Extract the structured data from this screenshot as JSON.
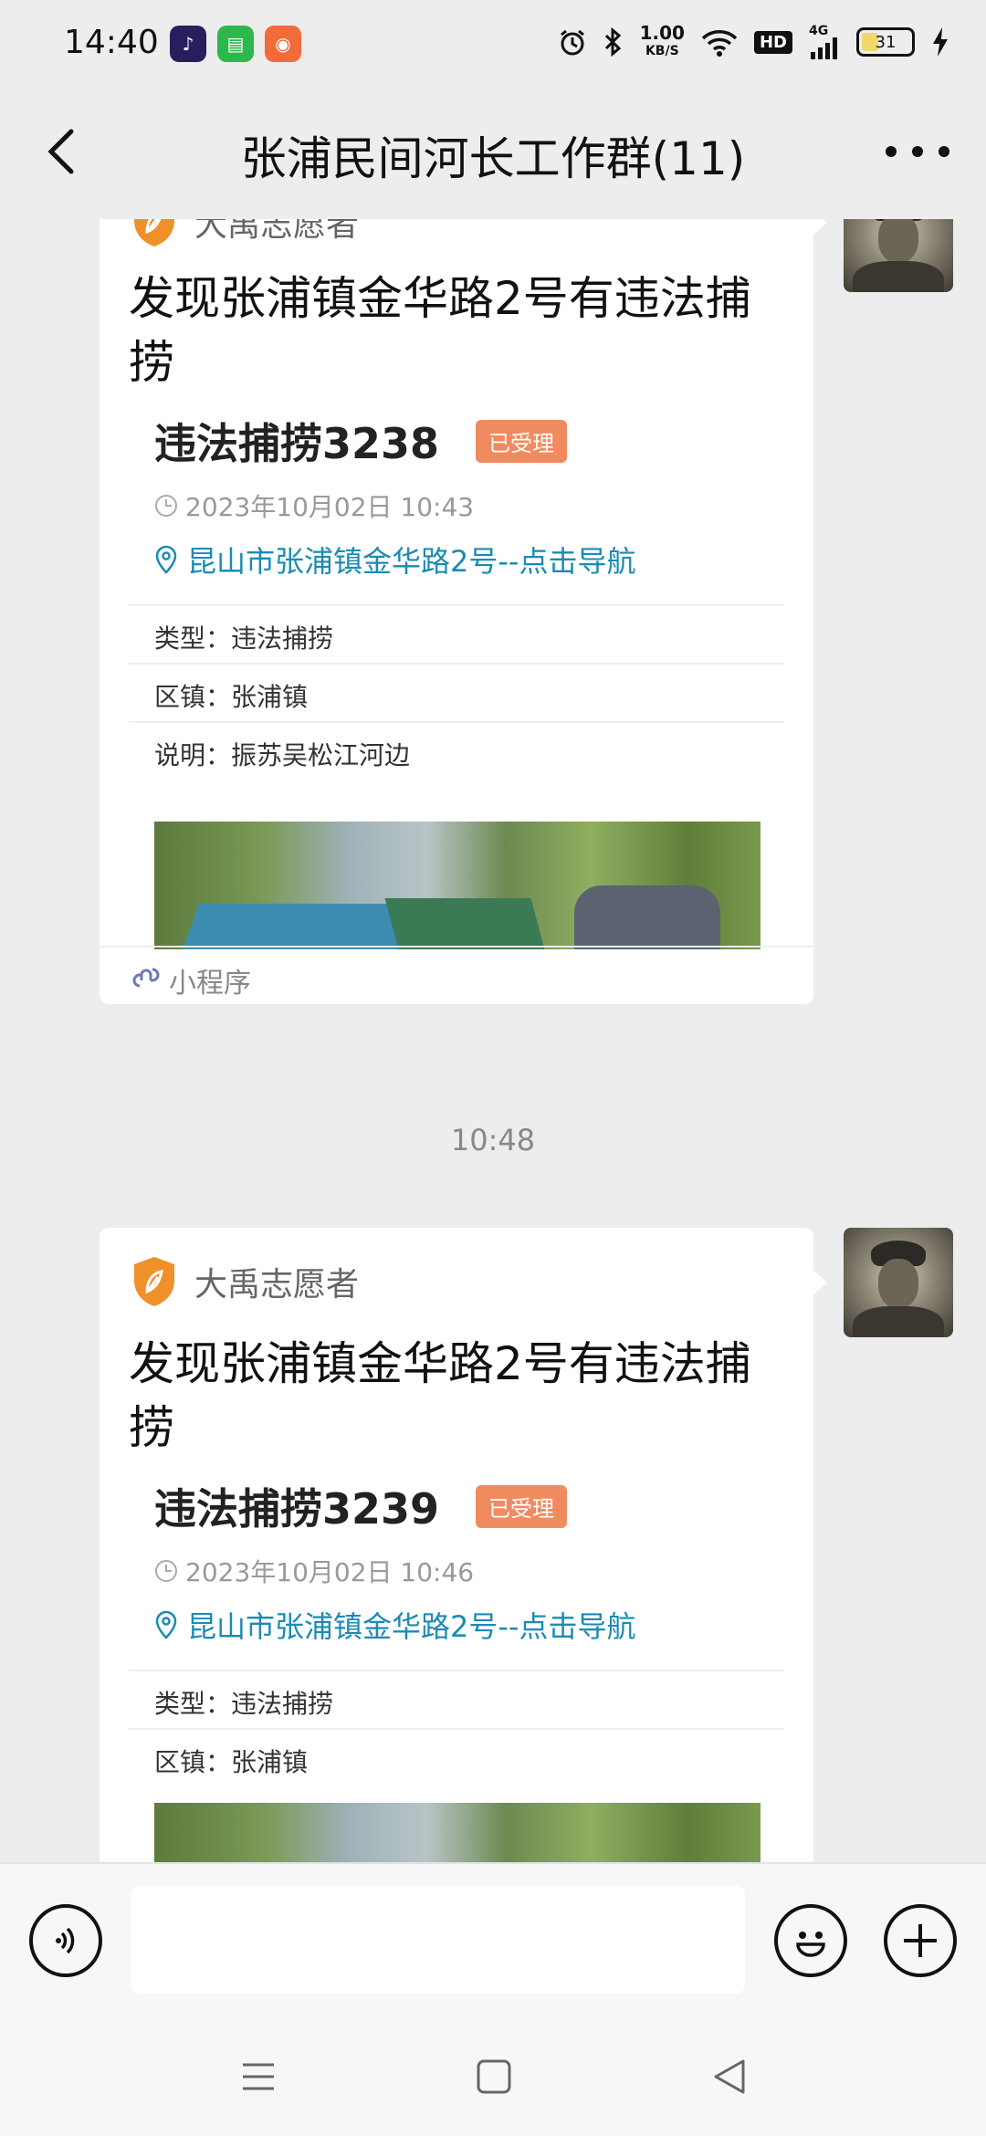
{
  "status_bar": {
    "time": "14:40",
    "speed_value": "1.00",
    "speed_unit": "KB/S",
    "hd": "HD",
    "network": "4G",
    "battery": "31",
    "icons": [
      "tiktok-icon",
      "messages-icon",
      "app-icon",
      "alarm-icon",
      "bluetooth-icon",
      "wifi-icon",
      "signal-icon",
      "charging-icon"
    ]
  },
  "header": {
    "title": "张浦民间河长工作群(11)"
  },
  "messages": [
    {
      "brand": "大禹志愿者",
      "title": "发现张浦镇金华路2号有违法捕捞",
      "case_no": "违法捕捞3238",
      "status": "已受理",
      "datetime": "2023年10月02日 10:43",
      "location": "昆山市张浦镇金华路2号--点击导航",
      "type_line": "类型：违法捕捞",
      "town_line": "区镇：张浦镇",
      "desc_line": "说明：振苏吴松江河边",
      "footer": "小程序"
    },
    {
      "brand": "大禹志愿者",
      "title": "发现张浦镇金华路2号有违法捕捞",
      "case_no": "违法捕捞3239",
      "status": "已受理",
      "datetime": "2023年10月02日 10:46",
      "location": "昆山市张浦镇金华路2号--点击导航",
      "type_line": "类型：违法捕捞",
      "town_line": "区镇：张浦镇"
    }
  ],
  "separator_time": "10:48",
  "input": {
    "placeholder": ""
  },
  "colors": {
    "accent_orange": "#f08b5f",
    "link_blue": "#1b8bb4",
    "brand_orange": "#f0902a"
  }
}
